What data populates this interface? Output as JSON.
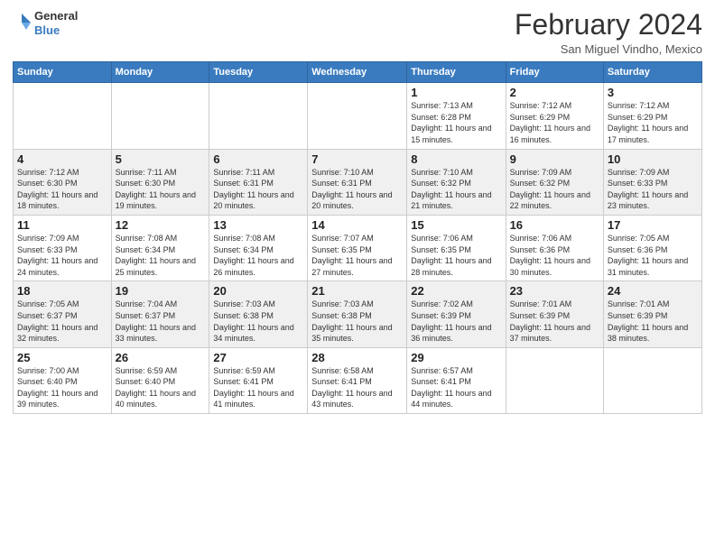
{
  "header": {
    "logo_line1": "General",
    "logo_line2": "Blue",
    "main_title": "February 2024",
    "subtitle": "San Miguel Vindho, Mexico"
  },
  "days_of_week": [
    "Sunday",
    "Monday",
    "Tuesday",
    "Wednesday",
    "Thursday",
    "Friday",
    "Saturday"
  ],
  "weeks": [
    [
      {
        "day": "",
        "info": ""
      },
      {
        "day": "",
        "info": ""
      },
      {
        "day": "",
        "info": ""
      },
      {
        "day": "",
        "info": ""
      },
      {
        "day": "1",
        "info": "Sunrise: 7:13 AM\nSunset: 6:28 PM\nDaylight: 11 hours and 15 minutes."
      },
      {
        "day": "2",
        "info": "Sunrise: 7:12 AM\nSunset: 6:29 PM\nDaylight: 11 hours and 16 minutes."
      },
      {
        "day": "3",
        "info": "Sunrise: 7:12 AM\nSunset: 6:29 PM\nDaylight: 11 hours and 17 minutes."
      }
    ],
    [
      {
        "day": "4",
        "info": "Sunrise: 7:12 AM\nSunset: 6:30 PM\nDaylight: 11 hours and 18 minutes."
      },
      {
        "day": "5",
        "info": "Sunrise: 7:11 AM\nSunset: 6:30 PM\nDaylight: 11 hours and 19 minutes."
      },
      {
        "day": "6",
        "info": "Sunrise: 7:11 AM\nSunset: 6:31 PM\nDaylight: 11 hours and 20 minutes."
      },
      {
        "day": "7",
        "info": "Sunrise: 7:10 AM\nSunset: 6:31 PM\nDaylight: 11 hours and 20 minutes."
      },
      {
        "day": "8",
        "info": "Sunrise: 7:10 AM\nSunset: 6:32 PM\nDaylight: 11 hours and 21 minutes."
      },
      {
        "day": "9",
        "info": "Sunrise: 7:09 AM\nSunset: 6:32 PM\nDaylight: 11 hours and 22 minutes."
      },
      {
        "day": "10",
        "info": "Sunrise: 7:09 AM\nSunset: 6:33 PM\nDaylight: 11 hours and 23 minutes."
      }
    ],
    [
      {
        "day": "11",
        "info": "Sunrise: 7:09 AM\nSunset: 6:33 PM\nDaylight: 11 hours and 24 minutes."
      },
      {
        "day": "12",
        "info": "Sunrise: 7:08 AM\nSunset: 6:34 PM\nDaylight: 11 hours and 25 minutes."
      },
      {
        "day": "13",
        "info": "Sunrise: 7:08 AM\nSunset: 6:34 PM\nDaylight: 11 hours and 26 minutes."
      },
      {
        "day": "14",
        "info": "Sunrise: 7:07 AM\nSunset: 6:35 PM\nDaylight: 11 hours and 27 minutes."
      },
      {
        "day": "15",
        "info": "Sunrise: 7:06 AM\nSunset: 6:35 PM\nDaylight: 11 hours and 28 minutes."
      },
      {
        "day": "16",
        "info": "Sunrise: 7:06 AM\nSunset: 6:36 PM\nDaylight: 11 hours and 30 minutes."
      },
      {
        "day": "17",
        "info": "Sunrise: 7:05 AM\nSunset: 6:36 PM\nDaylight: 11 hours and 31 minutes."
      }
    ],
    [
      {
        "day": "18",
        "info": "Sunrise: 7:05 AM\nSunset: 6:37 PM\nDaylight: 11 hours and 32 minutes."
      },
      {
        "day": "19",
        "info": "Sunrise: 7:04 AM\nSunset: 6:37 PM\nDaylight: 11 hours and 33 minutes."
      },
      {
        "day": "20",
        "info": "Sunrise: 7:03 AM\nSunset: 6:38 PM\nDaylight: 11 hours and 34 minutes."
      },
      {
        "day": "21",
        "info": "Sunrise: 7:03 AM\nSunset: 6:38 PM\nDaylight: 11 hours and 35 minutes."
      },
      {
        "day": "22",
        "info": "Sunrise: 7:02 AM\nSunset: 6:39 PM\nDaylight: 11 hours and 36 minutes."
      },
      {
        "day": "23",
        "info": "Sunrise: 7:01 AM\nSunset: 6:39 PM\nDaylight: 11 hours and 37 minutes."
      },
      {
        "day": "24",
        "info": "Sunrise: 7:01 AM\nSunset: 6:39 PM\nDaylight: 11 hours and 38 minutes."
      }
    ],
    [
      {
        "day": "25",
        "info": "Sunrise: 7:00 AM\nSunset: 6:40 PM\nDaylight: 11 hours and 39 minutes."
      },
      {
        "day": "26",
        "info": "Sunrise: 6:59 AM\nSunset: 6:40 PM\nDaylight: 11 hours and 40 minutes."
      },
      {
        "day": "27",
        "info": "Sunrise: 6:59 AM\nSunset: 6:41 PM\nDaylight: 11 hours and 41 minutes."
      },
      {
        "day": "28",
        "info": "Sunrise: 6:58 AM\nSunset: 6:41 PM\nDaylight: 11 hours and 43 minutes."
      },
      {
        "day": "29",
        "info": "Sunrise: 6:57 AM\nSunset: 6:41 PM\nDaylight: 11 hours and 44 minutes."
      },
      {
        "day": "",
        "info": ""
      },
      {
        "day": "",
        "info": ""
      }
    ]
  ],
  "colors": {
    "header_bg": "#3a7bbf",
    "header_text": "#ffffff",
    "border": "#cccccc",
    "odd_row_bg": "#ffffff",
    "even_row_bg": "#f0f0f0"
  }
}
